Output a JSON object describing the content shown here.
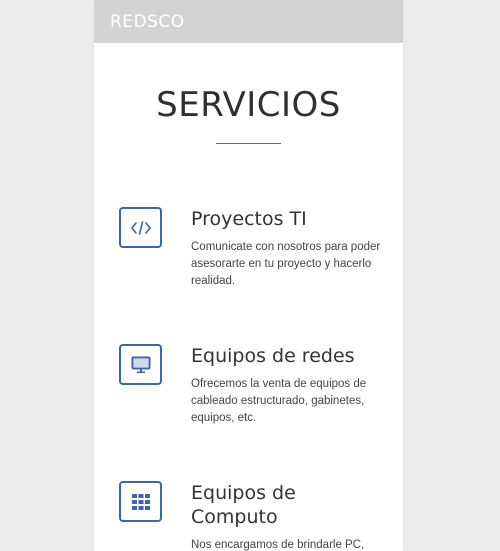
{
  "header": {
    "brand": "REDSCO"
  },
  "section": {
    "title": "SERVICIOS"
  },
  "services": [
    {
      "icon": "code-icon",
      "title": "Proyectos TI",
      "description": "Comunicate con nosotros para poder asesorarte en tu proyecto y hacerlo realidad."
    },
    {
      "icon": "monitor-icon",
      "title": "Equipos de redes",
      "description": "Ofrecemos la venta de equipos de cableado estructurado, gabinetes, equipos, etc."
    },
    {
      "icon": "grid-icon",
      "title": "Equipos de Computo",
      "description": "Nos encargamos de brindarle PC, Laptops, accesorios y más."
    }
  ],
  "colors": {
    "header_bg": "#d3d3d3",
    "accent": "#3b67a8",
    "background": "#ffffff"
  }
}
